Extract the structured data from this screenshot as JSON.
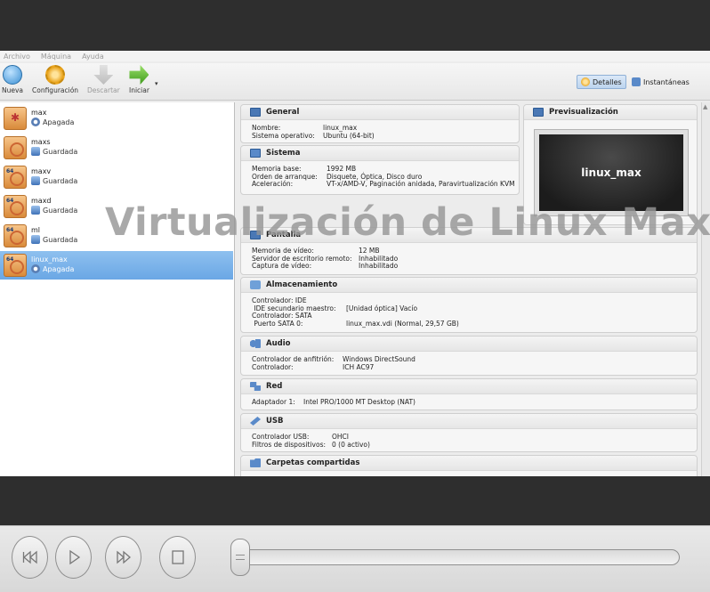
{
  "menu": [
    "Archivo",
    "Máquina",
    "Ayuda"
  ],
  "toolbar": {
    "new_label": "Nueva",
    "config_label": "Configuración",
    "discard_label": "Descartar",
    "start_label": "Iniciar",
    "details_label": "Detalles",
    "snapshots_label": "Instantáneas"
  },
  "vms": [
    {
      "name": "max",
      "state": "Apagada",
      "state_icon": "powered-off-icon",
      "os_icon": "generic-os-icon"
    },
    {
      "name": "maxs",
      "state": "Guardada",
      "state_icon": "saved-state-icon",
      "os_icon": "ubuntu-icon"
    },
    {
      "name": "maxv",
      "state": "Guardada",
      "state_icon": "saved-state-icon",
      "os_icon": "ubuntu-64-icon",
      "badge": "64"
    },
    {
      "name": "maxd",
      "state": "Guardada",
      "state_icon": "saved-state-icon",
      "os_icon": "ubuntu-64-icon",
      "badge": "64"
    },
    {
      "name": "ml",
      "state": "Guardada",
      "state_icon": "saved-state-icon",
      "os_icon": "ubuntu-64-icon",
      "badge": "64"
    },
    {
      "name": "linux_max",
      "state": "Apagada",
      "state_icon": "powered-off-icon",
      "os_icon": "ubuntu-64-icon",
      "badge": "64",
      "selected": true
    }
  ],
  "sections": {
    "general": {
      "title": "General",
      "rows": [
        {
          "k": "Nombre:",
          "v": "linux_max"
        },
        {
          "k": "Sistema operativo:",
          "v": "Ubuntu (64-bit)"
        }
      ]
    },
    "sistema": {
      "title": "Sistema",
      "rows": [
        {
          "k": "Memoria base:",
          "v": "1992 MB"
        },
        {
          "k": "Orden de arranque:",
          "v": "Disquete, Óptica, Disco duro"
        },
        {
          "k": "Aceleración:",
          "v": "VT-x/AMD-V, Paginación anidada, Paravirtualización KVM"
        }
      ]
    },
    "previsualizacion": {
      "title": "Previsualización",
      "screen_text": "linux_max"
    },
    "pantalla": {
      "title": "Pantalla",
      "rows": [
        {
          "k": "Memoria de vídeo:",
          "v": "12 MB"
        },
        {
          "k": "Servidor de escritorio remoto:",
          "v": "Inhabilitado"
        },
        {
          "k": "Captura de vídeo:",
          "v": "Inhabilitado"
        }
      ]
    },
    "almacenamiento": {
      "title": "Almacenamiento",
      "rows": [
        {
          "k": "Controlador: IDE",
          "v": ""
        },
        {
          "k": " IDE secundario maestro:",
          "v": "[Unidad óptica] Vacío"
        },
        {
          "k": "Controlador: SATA",
          "v": ""
        },
        {
          "k": " Puerto SATA 0:",
          "v": "linux_max.vdi (Normal, 29,57 GB)"
        }
      ]
    },
    "audio": {
      "title": "Audio",
      "rows": [
        {
          "k": "Controlador de anfitrión:",
          "v": "Windows DirectSound"
        },
        {
          "k": "Controlador:",
          "v": "ICH AC97"
        }
      ]
    },
    "red": {
      "title": "Red",
      "rows": [
        {
          "k": "Adaptador 1:",
          "v": "Intel PRO/1000 MT Desktop (NAT)"
        }
      ]
    },
    "usb": {
      "title": "USB",
      "rows": [
        {
          "k": "Controlador USB:",
          "v": "OHCI"
        },
        {
          "k": "Filtros de dispositivos:",
          "v": "0 (0 activo)"
        }
      ]
    },
    "carpetas": {
      "title": "Carpetas compartidas"
    }
  },
  "watermark": "Virtualización de Linux Max",
  "player": {
    "progress_fraction": 0.0
  }
}
